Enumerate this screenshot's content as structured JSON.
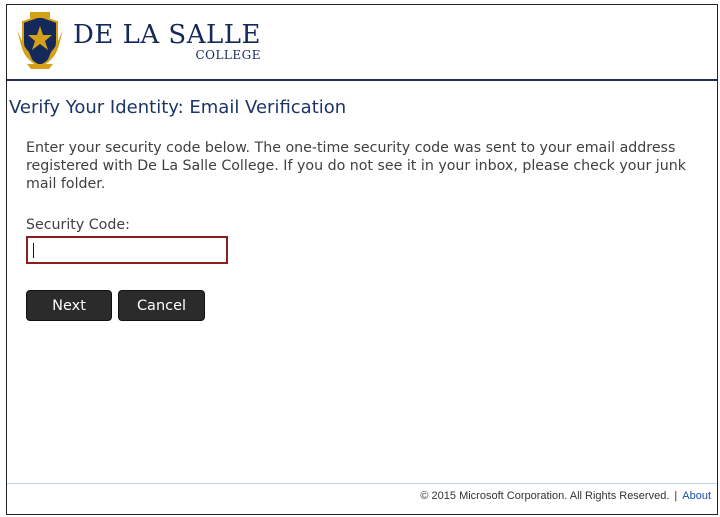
{
  "brand": {
    "name_top": "DE LA SALLE",
    "name_bottom": "COLLEGE",
    "colors": {
      "navy": "#14285a",
      "gold": "#d4a017",
      "input_border": "#8b1e1e"
    }
  },
  "page": {
    "title": "Verify Your Identity:  Email Verification",
    "description": "Enter your security code below. The one-time security code was sent to your email address registered with De La Salle College. If you do not see it in your inbox, please check your junk mail folder."
  },
  "form": {
    "security_code_label": "Security Code:",
    "security_code_value": "",
    "next_label": "Next",
    "cancel_label": "Cancel"
  },
  "footer": {
    "copyright": "© 2015 Microsoft Corporation. All Rights Reserved.",
    "separator": "|",
    "about_label": "About"
  }
}
